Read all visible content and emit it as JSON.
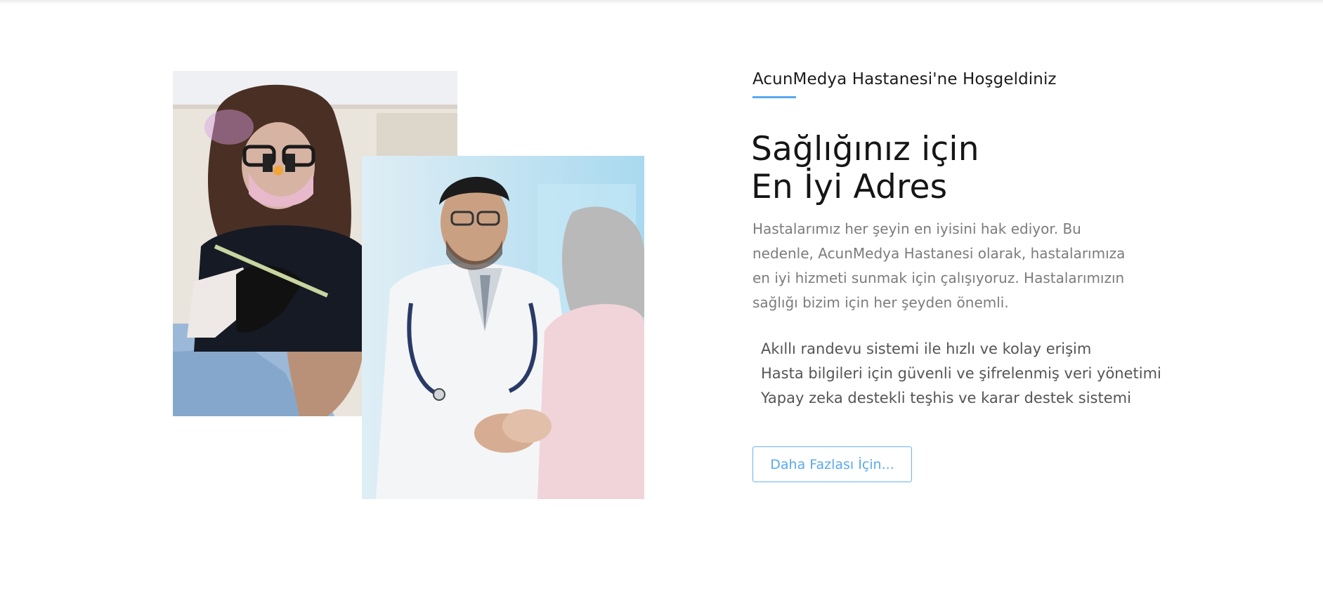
{
  "welcome": {
    "subtitle": "AcunMedya Hastanesi'ne Hoşgeldiniz"
  },
  "headline": {
    "line1": "Sağlığınız için",
    "line2": "En İyi Adres"
  },
  "intro": {
    "text": "Hastalarımız her şeyin en iyisini hak ediyor. Bu nedenle, AcunMedya Hastanesi olarak, hastalarımıza en iyi hizmeti sunmak için çalışıyoruz. Hastalarımızın sağlığı bizim için her şeyden önemli."
  },
  "features": [
    "Akıllı randevu sistemi ile hızlı ve kolay erişim",
    "Hasta bilgileri için güvenli ve şifrelenmiş veri yönetimi",
    "Yapay zeka destekli teşhis ve karar destek sistemi"
  ],
  "cta": {
    "label": "Daha Fazlası İçin..."
  },
  "colors": {
    "accent": "#5aa9ee",
    "heading": "#151515",
    "body_text": "#7c7c7c",
    "list_text": "#555555"
  }
}
